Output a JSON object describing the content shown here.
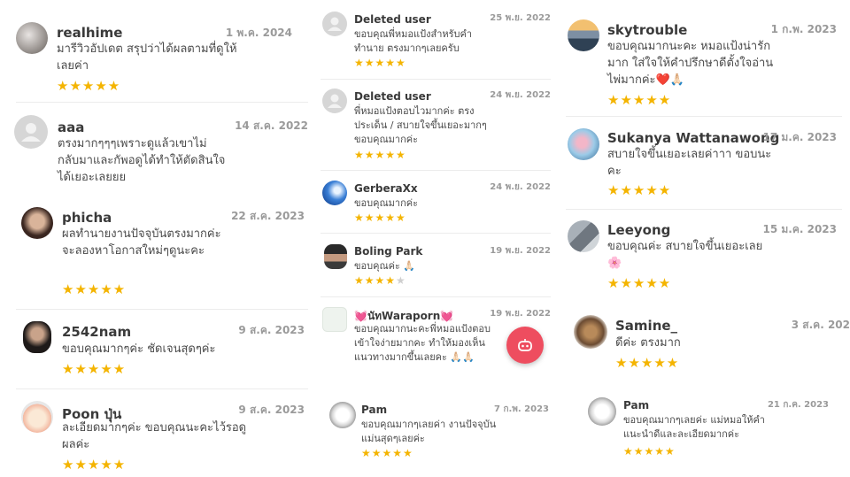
{
  "columns": [
    {
      "reviews": [
        {
          "name": "realhime",
          "date": "1 พ.ค. 2024",
          "text": "มารีวิวอัปเดต สรุปว่าได้ผลตามที่ดูให้เลยค่า",
          "stars": 5,
          "avatar": "cat-photo-avatar"
        },
        {
          "name": "aaa",
          "date": "14 ส.ค. 2022",
          "text": "ตรงมากๆๆๆเพราะดูแล้วเขาไม่กลับมาและกัพอดูได้ทำให้ตัดสินใจได้เยอะเลยยย",
          "stars": 0,
          "avatar": "default-user-avatar"
        },
        {
          "name": "phicha",
          "date": "22 ส.ค. 2023",
          "text": "ผลทำนายงานปัจจุบันตรงมากค่ะ จะลองหาโอกาสใหม่ๆดูนะคะ",
          "stars": 5,
          "avatar": "woman-portrait-avatar"
        },
        {
          "name": "2542nam",
          "date": "9 ส.ค. 2023",
          "text": "ขอบคุณมากๆค่ะ ชัดเจนสุดๆค่ะ",
          "stars": 5,
          "avatar": "woman-dark-portrait-avatar"
        },
        {
          "name": "Poon ปุ่น",
          "date": "9 ส.ค. 2023",
          "text": "ละเอียดมากๆค่ะ ขอบคุณนะคะไว้รอดูผลค่ะ",
          "stars": 5,
          "avatar": "cartoon-avatar"
        }
      ]
    },
    {
      "reviews": [
        {
          "name": "Deleted user",
          "date": "25 พ.ย. 2022",
          "text": "ขอบคุณพี่หมอแป้งสำหรับคำทำนาย ตรงมากๆเลยครับ",
          "stars": 5,
          "avatar": "default-user-avatar"
        },
        {
          "name": "Deleted user",
          "date": "24 พ.ย. 2022",
          "text": "พี่หมอแป้งตอบไวมากค่ะ ตรงประเด็น / สบายใจขึ้นเยอะมากๆ ขอบคุณมากค่ะ",
          "stars": 5,
          "avatar": "default-user-avatar"
        },
        {
          "name": "GerberaXx",
          "date": "24 พ.ย. 2022",
          "text": "ขอบคุณมากค่ะ",
          "stars": 5,
          "avatar": "blue-sky-avatar"
        },
        {
          "name": "Boling Park",
          "date": "19 พ.ย. 2022",
          "text": "ขอบคุณค่ะ 🙏🏻",
          "stars": 4,
          "avatar": "sunglasses-portrait-avatar"
        },
        {
          "name": "💓นัทWaraporn💓",
          "date": "19 พ.ย. 2022",
          "text": "ขอบคุณมากนะคะพี่หมอแป้งตอบเข้าใจง่ายมากคะ ทำให้มองเห็นแนวทางมากขึ้นเลยคะ 🙏🏻🙏🏻",
          "stars": 0,
          "avatar": "illustration-avatar"
        },
        {
          "name": "Pam",
          "date": "7 ก.พ. 2023",
          "text": "ขอบคุณมากๆเลยค่า งานปัจจุบันแม่นสุดๆเลยค่ะ",
          "stars": 5,
          "avatar": "white-dog-avatar"
        }
      ]
    },
    {
      "reviews": [
        {
          "name": "skytrouble",
          "date": "1 ก.พ. 2023",
          "text": "ขอบคุณมากนะคะ หมอแป้งน่ารักมาก ใส่ใจให้คำปรึกษาดีตั้งใจอ่านไพ่มากค่ะ❤️🙏🏻",
          "stars": 5,
          "avatar": "sunset-landscape-avatar"
        },
        {
          "name": "Sukanya Wattanawong",
          "date": "17 ม.ค. 2023",
          "text": "สบายใจขึ้นเยอะเลยค่าาา ขอบนะคะ",
          "stars": 5,
          "avatar": "family-photo-avatar"
        },
        {
          "name": "Leeyong",
          "date": "15 ม.ค. 2023",
          "text": "ขอบคุณค่ะ สบายใจขึ้นเยอะเลย🌸",
          "stars": 5,
          "avatar": "street-photo-avatar"
        },
        {
          "name": "Samine_",
          "date": "3 ส.ค. 202",
          "text": "ดีค่ะ ตรงมาก",
          "stars": 5,
          "avatar": "food-photo-avatar"
        },
        {
          "name": "Pam",
          "date": "21 ก.ค. 2023",
          "text": "ขอบคุณมากๆเลยค่ะ แม่หมอให้คำแนะนำดีและละเอียดมากค่ะ",
          "stars": 5,
          "avatar": "white-dog-avatar"
        }
      ]
    }
  ],
  "fab": {
    "icon": "chat-assistant-icon"
  },
  "colors": {
    "star": "#f4b400",
    "star_off": "#cfcfcf",
    "fab": "#ee4d5f",
    "date": "#9a9a9a",
    "separator": "#ececec"
  }
}
